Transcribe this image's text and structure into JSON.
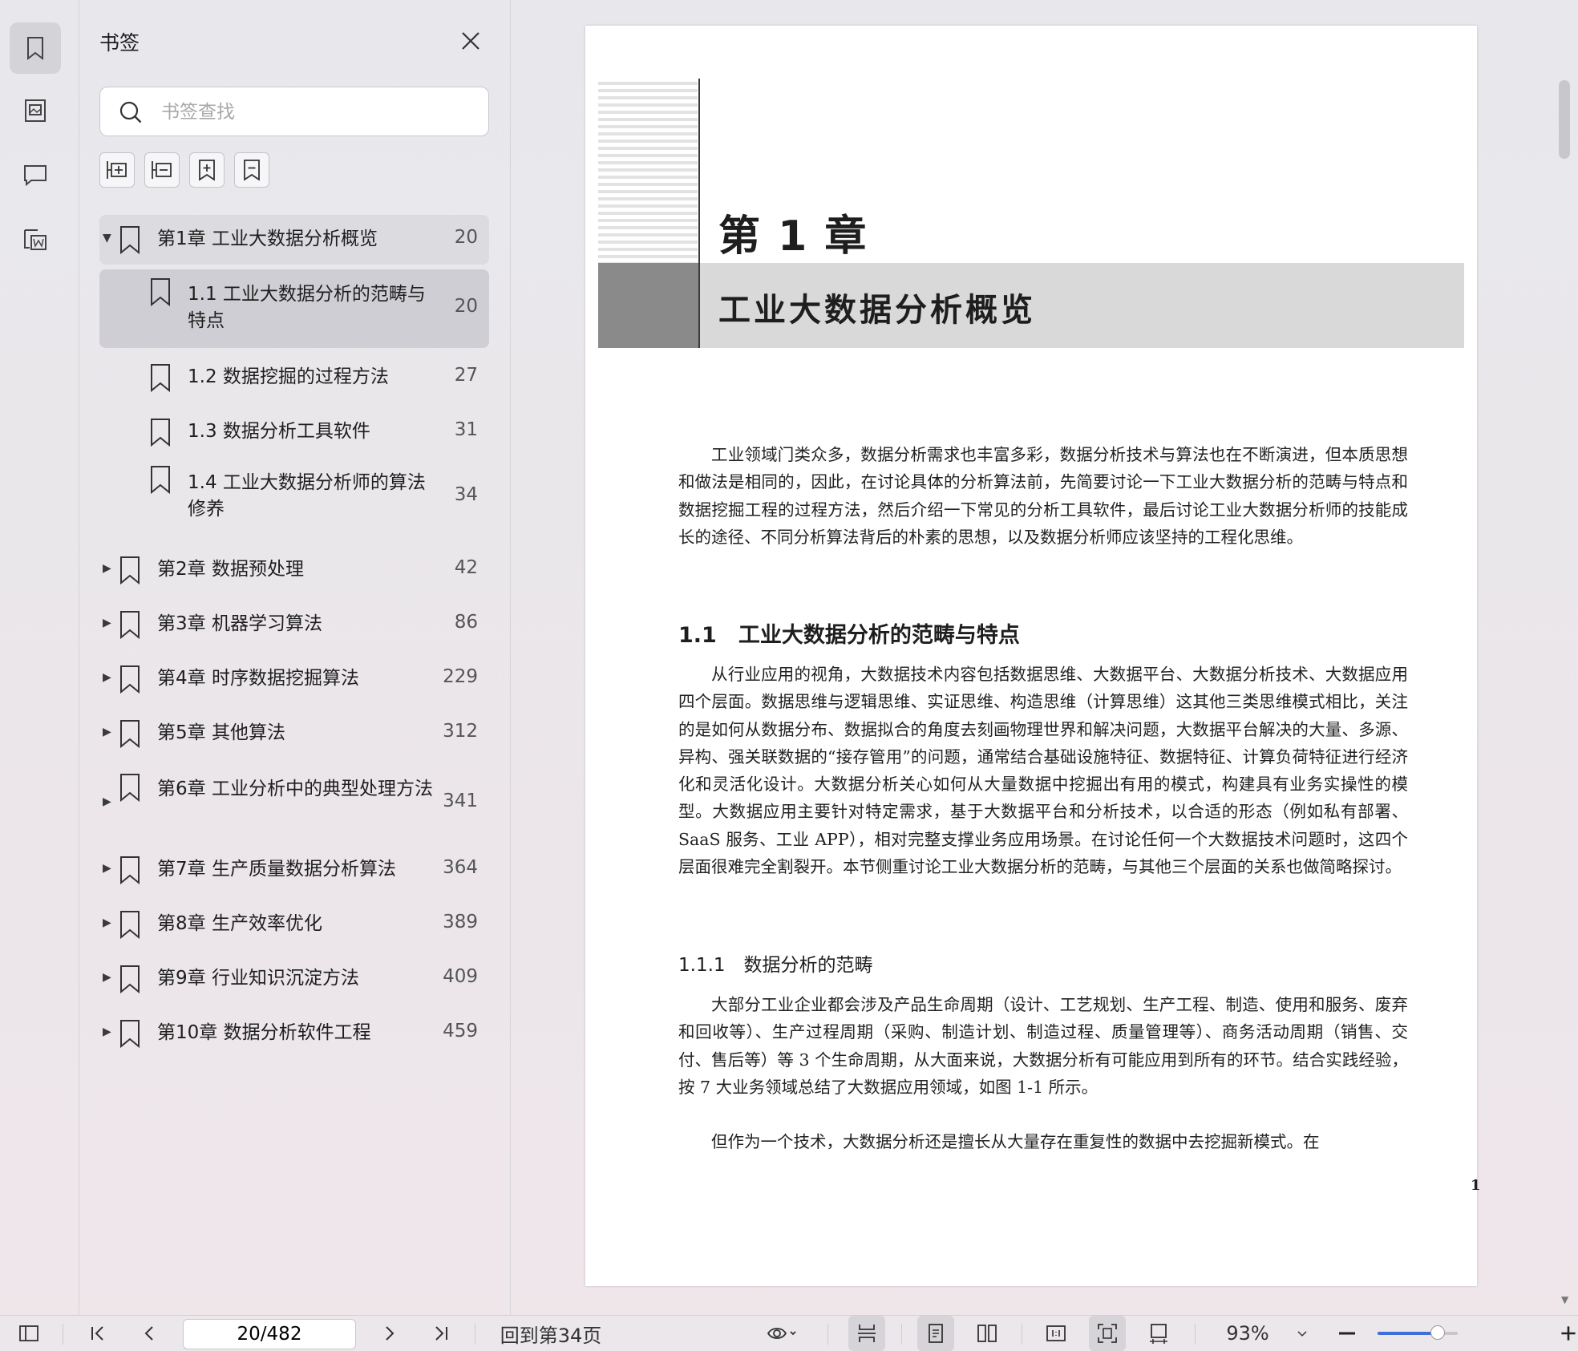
{
  "rail": {
    "items": [
      {
        "name": "bookmark-panel-button",
        "icon": "bookmark-icon",
        "active": true
      },
      {
        "name": "thumbnail-panel-button",
        "icon": "image-icon",
        "active": false
      },
      {
        "name": "comment-panel-button",
        "icon": "comment-icon",
        "active": false
      },
      {
        "name": "word-convert-button",
        "icon": "word-icon",
        "active": false
      }
    ]
  },
  "panel": {
    "title": "书签",
    "search_placeholder": "书签查找"
  },
  "bookmarks": [
    {
      "label": "第1章 工业大数据分析概览",
      "page": "20",
      "level": 0,
      "expanded": true
    },
    {
      "label": "1.1 工业大数据分析的范畴与特点",
      "page": "20",
      "level": 1,
      "selected": true
    },
    {
      "label": "1.2 数据挖掘的过程方法",
      "page": "27",
      "level": 1
    },
    {
      "label": "1.3 数据分析工具软件",
      "page": "31",
      "level": 1
    },
    {
      "label": "1.4 工业大数据分析师的算法修养",
      "page": "34",
      "level": 1
    },
    {
      "label": "第2章 数据预处理",
      "page": "42",
      "level": 0
    },
    {
      "label": "第3章 机器学习算法",
      "page": "86",
      "level": 0
    },
    {
      "label": "第4章 时序数据挖掘算法",
      "page": "229",
      "level": 0
    },
    {
      "label": "第5章 其他算法",
      "page": "312",
      "level": 0
    },
    {
      "label": "第6章 工业分析中的典型处理方法",
      "page": "341",
      "level": 0
    },
    {
      "label": "第7章 生产质量数据分析算法",
      "page": "364",
      "level": 0
    },
    {
      "label": "第8章 生产效率优化",
      "page": "389",
      "level": 0
    },
    {
      "label": "第9章 行业知识沉淀方法",
      "page": "409",
      "level": 0
    },
    {
      "label": "第10章 数据分析软件工程",
      "page": "459",
      "level": 0
    }
  ],
  "document": {
    "chapter_number": "第 1 章",
    "chapter_title": "工业大数据分析概览",
    "intro": "工业领域门类众多，数据分析需求也丰富多彩，数据分析技术与算法也在不断演进，但本质思想和做法是相同的，因此，在讨论具体的分析算法前，先简要讨论一下工业大数据分析的范畴与特点和数据挖掘工程的过程方法，然后介绍一下常见的分析工具软件，最后讨论工业大数据分析师的技能成长的途径、不同分析算法背后的朴素的思想，以及数据分析师应该坚持的工程化思维。",
    "section_title": "1.1　工业大数据分析的范畴与特点",
    "section_para": "从行业应用的视角，大数据技术内容包括数据思维、大数据平台、大数据分析技术、大数据应用四个层面。数据思维与逻辑思维、实证思维、构造思维（计算思维）这其他三类思维模式相比，关注的是如何从数据分布、数据拟合的角度去刻画物理世界和解决问题，大数据平台解决的大量、多源、异构、强关联数据的“接存管用”的问题，通常结合基础设施特征、数据特征、计算负荷特征进行经济化和灵活化设计。大数据分析关心如何从大量数据中挖掘出有用的模式，构建具有业务实操性的模型。大数据应用主要针对特定需求，基于大数据平台和分析技术，以合适的形态（例如私有部署、SaaS 服务、工业 APP），相对完整支撑业务应用场景。在讨论任何一个大数据技术问题时，这四个层面很难完全割裂开。本节侧重讨论工业大数据分析的范畴，与其他三个层面的关系也做简略探讨。",
    "subsection_title": "1.1.1　数据分析的范畴",
    "subsection_para": "大部分工业企业都会涉及产品生命周期（设计、工艺规划、生产工程、制造、使用和服务、废弃和回收等）、生产过程周期（采购、制造计划、制造过程、质量管理等）、商务活动周期（销售、交付、售后等）等 3 个生命周期，从大面来说，大数据分析有可能应用到所有的环节。结合实践经验，按 7 大业务领域总结了大数据应用领域，如图 1-1 所示。",
    "last_para": "但作为一个技术，大数据分析还是擅长从大量存在重复性的数据中去挖掘新模式。在",
    "page_number": "1"
  },
  "statusbar": {
    "page_input": "20/482",
    "goto_label": "回到第34页",
    "zoom": "93%",
    "zoom_fraction": 0.75
  }
}
